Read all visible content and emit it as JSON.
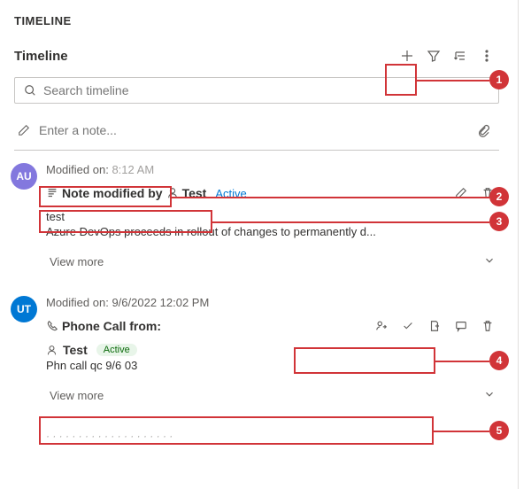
{
  "section_header": "TIMELINE",
  "toolbar": {
    "title": "Timeline"
  },
  "search": {
    "placeholder": "Search timeline"
  },
  "note_input": {
    "placeholder": "Enter a note..."
  },
  "entries": [
    {
      "avatar": {
        "initials": "AU",
        "bg": "#8378de"
      },
      "modified_label": "Modified on:",
      "modified_time": "8:12 AM",
      "subject": "Note modified by",
      "actor": "Test",
      "status": "Active",
      "body_title": "test",
      "body_text": "Azure DevOps proceeds in rollout of changes to permanently d...",
      "view_more": "View more"
    },
    {
      "avatar": {
        "initials": "UT",
        "bg": "#0078d4"
      },
      "modified_label": "Modified on:",
      "modified_time": "9/6/2022 12:02 PM",
      "subject": "Phone Call from:",
      "actor": "Test",
      "status": "Active",
      "body_title": "Phn call qc 9/6 03",
      "view_more": "View more"
    }
  ],
  "annotations": {
    "1": "1",
    "2": "2",
    "3": "3",
    "4": "4",
    "5": "5"
  },
  "colors": {
    "annotation": "#d13438"
  }
}
